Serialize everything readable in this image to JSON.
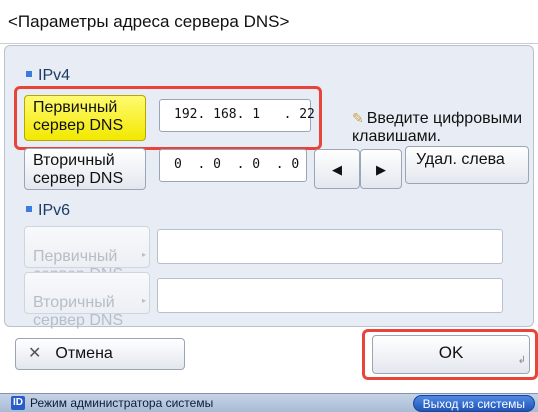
{
  "title": "<Параметры адреса сервера DNS>",
  "ipv4": {
    "section_label": "IPv4",
    "primary_button": "Первичный\nсервер DNS",
    "primary_value": "192. 168. 1   . 22",
    "secondary_button": "Вторичный\nсервер DNS",
    "secondary_value": "0  . 0  . 0  . 0",
    "hint": "Введите цифровыми\nклавишами.",
    "left_arrow": "◀",
    "right_arrow": "▶",
    "delete_left": "Удал. слева"
  },
  "ipv6": {
    "section_label": "IPv6",
    "primary_button": "Первичный\nсервер DNS",
    "secondary_button": "Вторичный\nсервер DNS",
    "primary_value": "",
    "secondary_value": ""
  },
  "actions": {
    "cancel_icon": "✕",
    "cancel_label": "Отмена",
    "ok_label": "OK"
  },
  "footer": {
    "admin_badge": "ID",
    "admin_text": "Режим администратора системы",
    "logout_label": "Выход из системы"
  },
  "colors": {
    "highlight": "#e8443a",
    "active_button": "#f2e800",
    "logout": "#1f55b8"
  },
  "icons": {
    "hint": "keypad-hint-icon",
    "arrow_left": "left-arrow-icon",
    "arrow_right": "right-arrow-icon",
    "cancel": "close-icon"
  }
}
